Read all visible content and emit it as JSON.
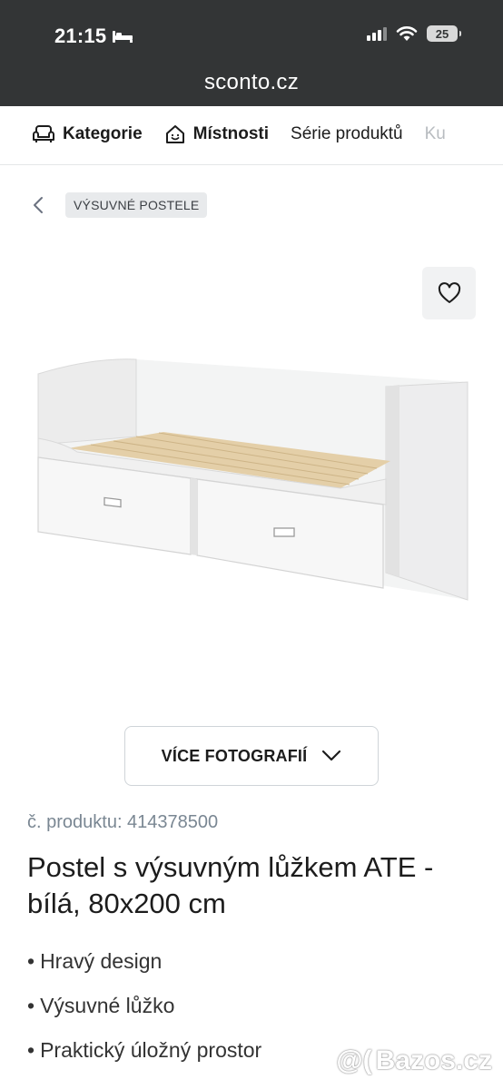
{
  "status_bar": {
    "time": "21:15",
    "battery": "25",
    "icons": [
      "bed-icon",
      "signal-icon",
      "wifi-icon",
      "battery-icon"
    ]
  },
  "browser": {
    "url": "sconto.cz"
  },
  "category_nav": {
    "items": [
      {
        "label": "Kategorie",
        "icon": "sofa-icon"
      },
      {
        "label": "Místnosti",
        "icon": "house-icon"
      },
      {
        "label": "Série produktů"
      },
      {
        "label": "Ku"
      }
    ]
  },
  "breadcrumb": {
    "label": "VÝSUVNÉ POSTELE",
    "back_icon": "chevron-left-icon"
  },
  "product": {
    "more_photos_label": "VÍCE FOTOGRAFIÍ",
    "sku": "č. produktu: 414378500",
    "title": "Postel s výsuvným lůžkem ATE - bílá, 80x200 cm",
    "features": [
      "Hravý design",
      "Výsuvné lůžko",
      "Praktický úložný prostor"
    ]
  },
  "watermark": {
    "text": "Bazos.cz"
  },
  "colors": {
    "chrome": "#333536",
    "accent": "#1c1c1c",
    "muted_text": "#7a8793",
    "crumb_bg": "#e8eaec"
  }
}
